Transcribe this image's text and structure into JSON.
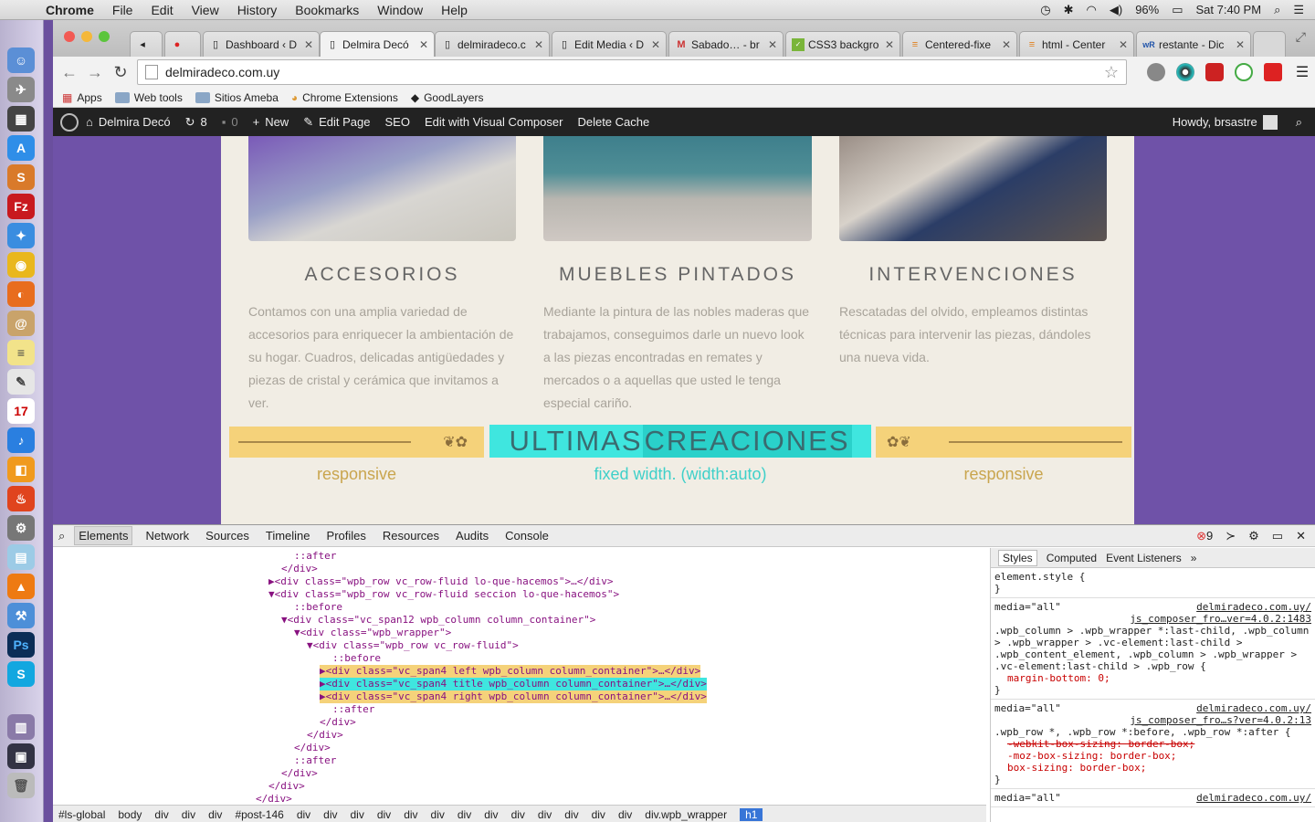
{
  "menubar": {
    "app": "Chrome",
    "items": [
      "File",
      "Edit",
      "View",
      "History",
      "Bookmarks",
      "Window",
      "Help"
    ],
    "battery": "96%",
    "clock": "Sat 7:40 PM"
  },
  "tabs": [
    {
      "title": "Dashboard ‹ D"
    },
    {
      "title": "Delmira Decó"
    },
    {
      "title": "delmiradeco.c"
    },
    {
      "title": "Edit Media ‹ D"
    },
    {
      "title": "Sabado… - br"
    },
    {
      "title": "CSS3 backgro"
    },
    {
      "title": "Centered-fixe"
    },
    {
      "title": "html - Center"
    },
    {
      "title": "restante - Dic"
    }
  ],
  "address": {
    "url": "delmiradeco.com.uy"
  },
  "bookmarks": [
    "Apps",
    "Web tools",
    "Sitios Ameba",
    "Chrome Extensions",
    "GoodLayers"
  ],
  "wpbar": {
    "site": "Delmira Decó",
    "updates": "8",
    "comments": "0",
    "new": "New",
    "edit_page": "Edit Page",
    "seo": "SEO",
    "vc": "Edit with Visual Composer",
    "cache": "Delete Cache",
    "howdy": "Howdy, brsastre"
  },
  "site": {
    "columns": [
      {
        "title": "ACCESORIOS",
        "text": "Contamos con una amplia variedad de accesorios para enriquecer la ambientación de su hogar. Cuadros, delicadas antigüedades y piezas de cristal y cerámica que invitamos a ver."
      },
      {
        "title": "MUEBLES PINTADOS",
        "text": "Mediante la pintura de las nobles maderas que trabajamos, conseguimos darle un nuevo look a las piezas encontradas en remates y mercados o a aquellas que usted le tenga especial cariño."
      },
      {
        "title": "INTERVENCIONES",
        "text": "Rescatadas del olvido, empleamos distintas técnicas para intervenir las piezas, dándoles una nueva vida."
      }
    ],
    "heading_part1": "ULTIMAS ",
    "heading_part2": "CREACIONES",
    "caption_left": "responsive",
    "caption_center": "fixed width. (width:auto)",
    "caption_right": "responsive"
  },
  "devtools": {
    "tabs": [
      "Elements",
      "Network",
      "Sources",
      "Timeline",
      "Profiles",
      "Resources",
      "Audits",
      "Console"
    ],
    "errors": "9",
    "dom": [
      {
        "indent": 16,
        "text": "::after",
        "kind": "pseudo"
      },
      {
        "indent": 15,
        "text": "</div>",
        "kind": "tag"
      },
      {
        "indent": 14,
        "text": "▶<div class=\"wpb_row vc_row-fluid lo-que-hacemos\">…</div>",
        "kind": "tag"
      },
      {
        "indent": 14,
        "text": "▼<div class=\"wpb_row vc_row-fluid seccion lo-que-hacemos\">",
        "kind": "tag"
      },
      {
        "indent": 16,
        "text": "::before",
        "kind": "pseudo"
      },
      {
        "indent": 15,
        "text": "▼<div class=\"vc_span12 wpb_column column_container\">",
        "kind": "tag"
      },
      {
        "indent": 16,
        "text": "▼<div class=\"wpb_wrapper\">",
        "kind": "tag"
      },
      {
        "indent": 17,
        "text": "▼<div class=\"wpb_row vc_row-fluid\">",
        "kind": "tag"
      },
      {
        "indent": 19,
        "text": "::before",
        "kind": "pseudo"
      },
      {
        "indent": 18,
        "text": "▶<div class=\"vc_span4 left wpb_column column_container\">…</div>",
        "kind": "hl-y"
      },
      {
        "indent": 18,
        "text": "▶<div class=\"vc_span4 title wpb_column column_container\">…</div>",
        "kind": "hl-c"
      },
      {
        "indent": 18,
        "text": "▶<div class=\"vc_span4 right wpb_column column_container\">…</div>",
        "kind": "hl-y"
      },
      {
        "indent": 19,
        "text": "::after",
        "kind": "pseudo"
      },
      {
        "indent": 18,
        "text": "</div>",
        "kind": "tag"
      },
      {
        "indent": 17,
        "text": "</div>",
        "kind": "tag"
      },
      {
        "indent": 16,
        "text": "</div>",
        "kind": "tag"
      },
      {
        "indent": 16,
        "text": "::after",
        "kind": "pseudo"
      },
      {
        "indent": 15,
        "text": "</div>",
        "kind": "tag"
      },
      {
        "indent": 14,
        "text": "</div>",
        "kind": "tag"
      },
      {
        "indent": 13,
        "text": "</div>",
        "kind": "tag"
      }
    ],
    "crumbs": [
      "#ls-global",
      "body",
      "div",
      "div",
      "div",
      "#post-146",
      "div",
      "div",
      "div",
      "div",
      "div",
      "div",
      "div",
      "div",
      "div",
      "div",
      "div",
      "div",
      "div",
      "div.wpb_wrapper"
    ],
    "crumb_selected": "h1",
    "styles_tabs": [
      "Styles",
      "Computed",
      "Event Listeners"
    ],
    "rules": [
      {
        "media": "",
        "selector": "element.style {",
        "src": "",
        "props": [],
        "close": "}"
      },
      {
        "media": "media=\"all\"",
        "selector": ".wpb_column >  .wpb_wrapper *:last-child, .wpb_column > .wpb_wrapper > .vc-element:last-child > .wpb_content_element, .wpb_column > .wpb_wrapper > .vc-element:last-child > .wpb_row {",
        "src": "js_composer_fro…ver=4.0.2:1483",
        "src_host": "delmiradeco.com.uy/",
        "props": [
          "margin-bottom: 0;"
        ],
        "strike": [
          false
        ],
        "close": "}"
      },
      {
        "media": "media=\"all\"",
        "selector": ".wpb_row *,  .wpb_row *:before, .wpb_row *:after {",
        "src": "js_composer_fro…s?ver=4.0.2:13",
        "src_host": "delmiradeco.com.uy/",
        "props": [
          "-webkit-box-sizing: border-box;",
          "-moz-box-sizing: border-box;",
          "box-sizing: border-box;"
        ],
        "strike": [
          true,
          false,
          false
        ],
        "close": "}"
      },
      {
        "media": "media=\"all\"",
        "selector": "",
        "src": "",
        "src_host": "delmiradeco.com.uy/",
        "props": [],
        "close": ""
      }
    ]
  },
  "colors": {
    "accent_yellow": "#f5d27a",
    "accent_cyan": "#3fe6df",
    "site_bg": "#6f52a8"
  }
}
